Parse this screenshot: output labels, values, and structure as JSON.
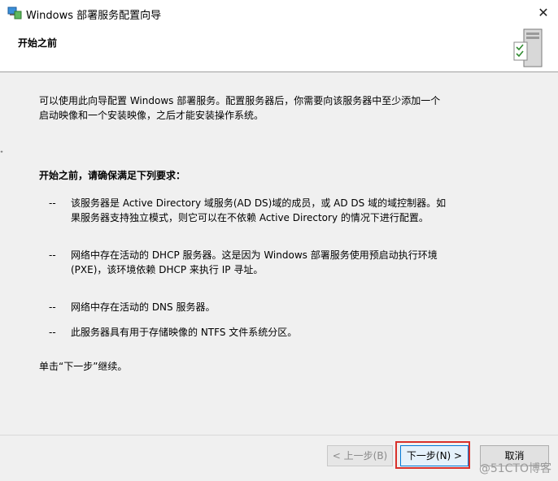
{
  "window": {
    "title": "Windows 部署服务配置向导",
    "close_glyph": "✕"
  },
  "header": {
    "title": "开始之前"
  },
  "content": {
    "intro_line1": "可以使用此向导配置 Windows 部署服务。配置服务器后，你需要向该服务器中至少添加一个",
    "intro_line2": "启动映像和一个安装映像，之后才能安装操作系统。",
    "req_heading": "开始之前，请确保满足下列要求：",
    "dash": "--",
    "requirements": [
      {
        "line1": "该服务器是 Active Directory 域服务(AD DS)域的成员，或 AD DS 域的域控制器。如",
        "line2": "果服务器支持独立模式，则它可以在不依赖 Active Directory 的情况下进行配置。"
      },
      {
        "line1": "网络中存在活动的 DHCP 服务器。这是因为 Windows 部署服务使用预启动执行环境",
        "line2": "(PXE)，该环境依赖 DHCP 来执行 IP 寻址。"
      },
      {
        "line1": "网络中存在活动的 DNS 服务器。",
        "line2": ""
      },
      {
        "line1": "此服务器具有用于存储映像的 NTFS 文件系统分区。",
        "line2": ""
      }
    ],
    "click_next": "单击“下一步”继续。",
    "left_tick": "ᐩ"
  },
  "buttons": {
    "back": "< 上一步(B)",
    "next": "下一步(N) >",
    "cancel": "取消"
  },
  "watermark": "@51CTO博客",
  "colors": {
    "highlight": "#d9312b",
    "focus": "#0078d7"
  }
}
